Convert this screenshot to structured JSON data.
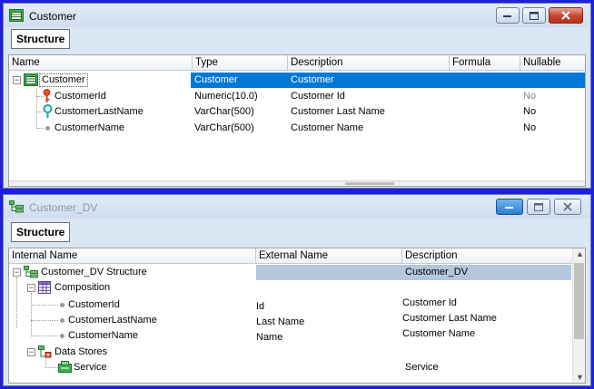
{
  "customer_window": {
    "title": "Customer",
    "structure_button": "Structure",
    "columns": [
      "Name",
      "Type",
      "Description",
      "Formula",
      "Nullable"
    ],
    "root": {
      "name": "Customer",
      "type": "Customer",
      "description": "Customer"
    },
    "attributes": [
      {
        "name": "CustomerId",
        "type": "Numeric(10.0)",
        "description": "Customer Id",
        "formula": "",
        "nullable": "No",
        "icon": "primary-key-icon"
      },
      {
        "name": "CustomerLastName",
        "type": "VarChar(500)",
        "description": "Customer Last Name",
        "formula": "",
        "nullable": "No",
        "icon": "search-key-icon"
      },
      {
        "name": "CustomerName",
        "type": "VarChar(500)",
        "description": "Customer Name",
        "formula": "",
        "nullable": "No",
        "icon": "bullet-icon"
      }
    ]
  },
  "dv_window": {
    "title": "Customer_DV",
    "structure_button": "Structure",
    "columns": [
      "Internal Name",
      "External Name",
      "Description"
    ],
    "root": {
      "name": "Customer_DV Structure",
      "external": "",
      "description": "Customer_DV"
    },
    "composition": {
      "name": "Composition"
    },
    "composition_items": [
      {
        "name": "CustomerId",
        "external": "Id",
        "description": "Customer Id"
      },
      {
        "name": "CustomerLastName",
        "external": "Last Name",
        "description": "Customer Last Name"
      },
      {
        "name": "CustomerName",
        "external": "Name",
        "description": "Customer Name"
      }
    ],
    "data_stores": {
      "name": "Data Stores"
    },
    "service": {
      "name": "Service",
      "description": "Service"
    }
  },
  "colors": {
    "selection": "#0078d7",
    "desktop": "#1e1ee0",
    "root_band": "#b4c7dc"
  }
}
